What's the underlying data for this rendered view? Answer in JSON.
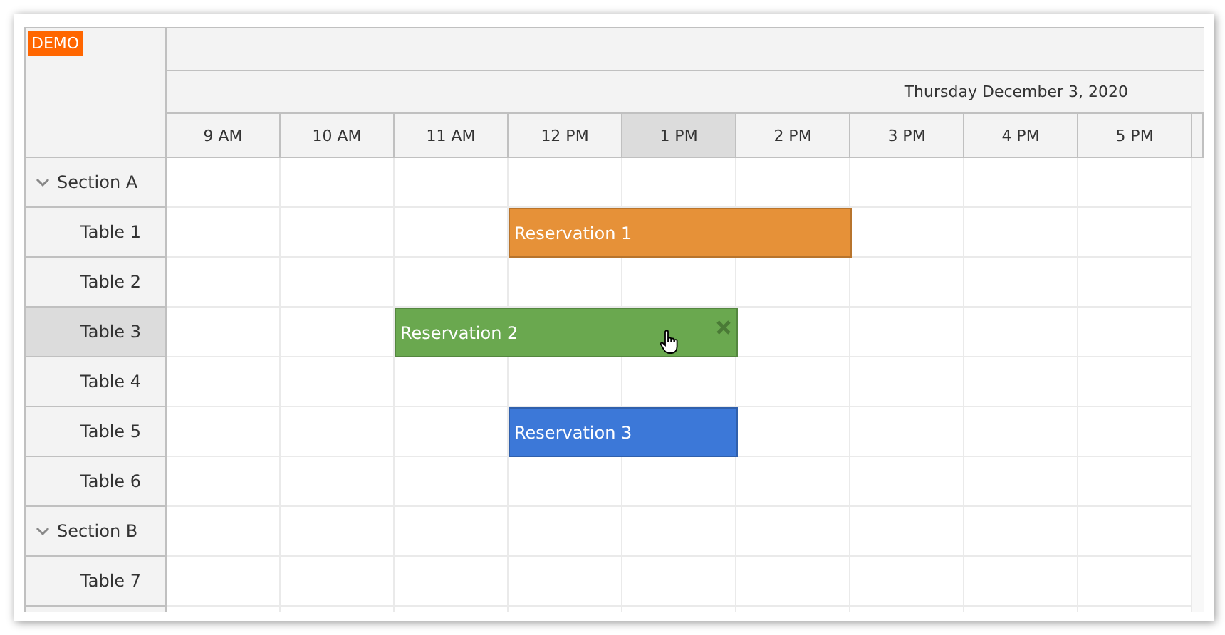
{
  "demo_badge": "DEMO",
  "timeline": {
    "date": "Thursday December 3, 2020",
    "hours": [
      {
        "label": "9 AM",
        "selected": false
      },
      {
        "label": "10 AM",
        "selected": false
      },
      {
        "label": "11 AM",
        "selected": false
      },
      {
        "label": "12 PM",
        "selected": false
      },
      {
        "label": "1 PM",
        "selected": true
      },
      {
        "label": "2 PM",
        "selected": false
      },
      {
        "label": "3 PM",
        "selected": false
      },
      {
        "label": "4 PM",
        "selected": false
      },
      {
        "label": "5 PM",
        "selected": false
      }
    ]
  },
  "resources": [
    {
      "name": "Section A",
      "expanded": true,
      "selected": false,
      "children": [
        {
          "name": "Table 1",
          "selected": false,
          "events": [
            {
              "text": "Reservation 1",
              "color": "#e69138",
              "deletable": false
            }
          ]
        },
        {
          "name": "Table 2",
          "selected": false
        },
        {
          "name": "Table 3",
          "selected": true,
          "events": [
            {
              "text": "Reservation 2",
              "color": "#6aa84f",
              "deletable": true
            }
          ]
        },
        {
          "name": "Table 4",
          "selected": false
        },
        {
          "name": "Table 5",
          "selected": false,
          "events": [
            {
              "text": "Reservation 3",
              "color": "#3c78d8",
              "deletable": false
            }
          ]
        },
        {
          "name": "Table 6",
          "selected": false
        }
      ]
    },
    {
      "name": "Section B",
      "expanded": true,
      "selected": false,
      "children": [
        {
          "name": "Table 7",
          "selected": false
        }
      ]
    }
  ]
}
